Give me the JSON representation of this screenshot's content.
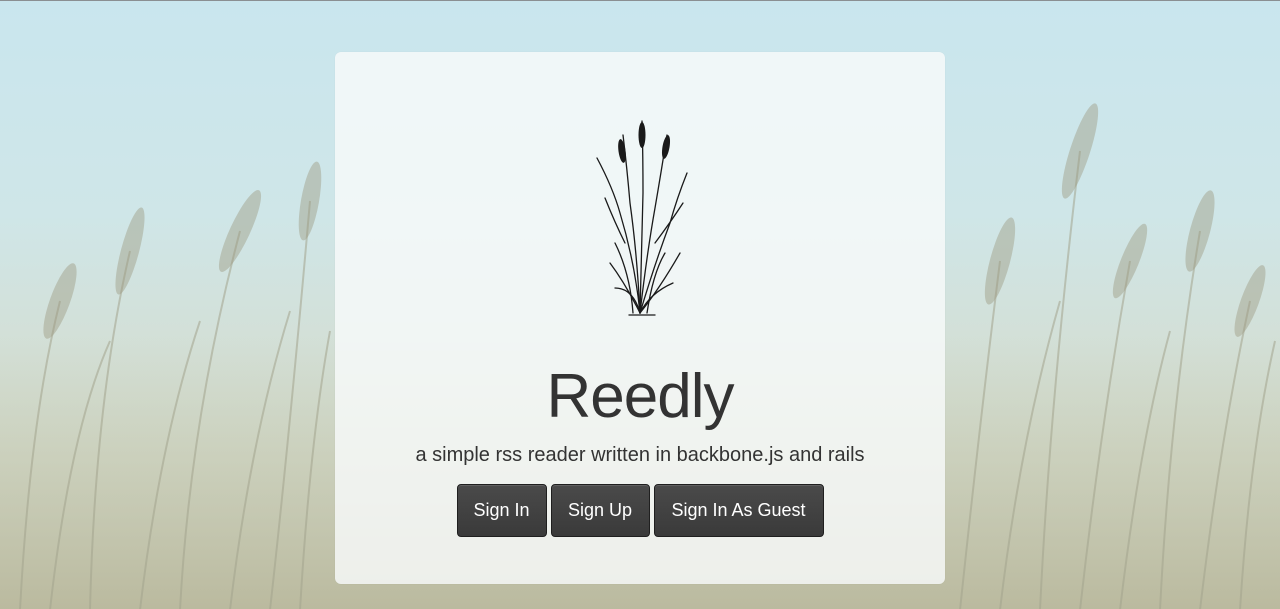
{
  "app": {
    "title": "Reedly",
    "tagline": "a simple rss reader written in backbone.js and rails"
  },
  "actions": {
    "sign_in_label": "Sign In",
    "sign_up_label": "Sign Up",
    "guest_label": "Sign In As Guest"
  },
  "icons": {
    "logo": "reed-plant-icon",
    "background": "reed-field-background"
  },
  "colors": {
    "button_bg": "#3f3f3f",
    "button_text": "#ffffff",
    "title_text": "#333333",
    "sky": "#c9e6ee"
  }
}
